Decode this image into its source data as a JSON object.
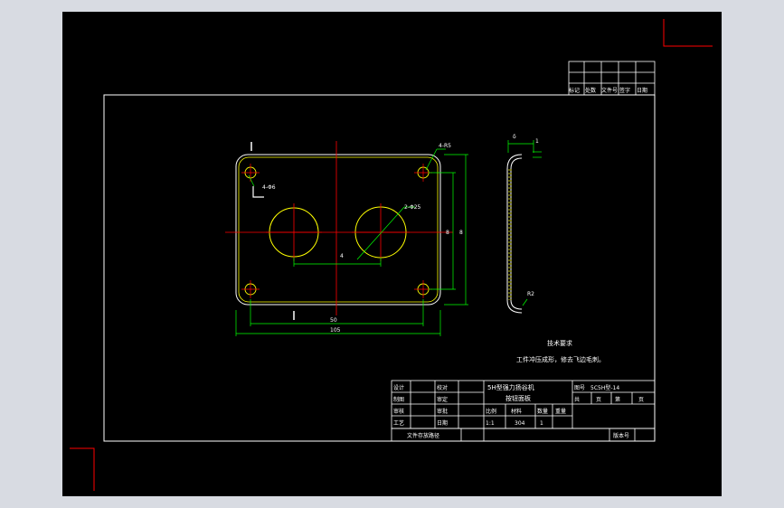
{
  "colors": {
    "background": "#000000",
    "frame": "#ffffff",
    "part_outline": "#ffff00",
    "centerline": "#ff0000",
    "dimension": "#00ff00",
    "corner_mark": "#ff0000"
  },
  "revision_table": {
    "headers": [
      "标记",
      "处数",
      "文件号",
      "签字",
      "日期"
    ]
  },
  "dimensions": {
    "corner_holes": "4-Φ6",
    "corner_radius": "4-R5",
    "large_holes": "2-Φ25",
    "hole_spacing": "4",
    "inner_height": "8",
    "outer_height": "8",
    "inner_width": "50",
    "outer_width": "105"
  },
  "side_view": {
    "thickness_label": "δ",
    "lip_label": "1",
    "radius_label": "R2"
  },
  "technical_requirements": {
    "heading": "技术要求",
    "text": "工件冲压成形，修去飞边毛刺。"
  },
  "title_block": {
    "labels": {
      "design": "设计",
      "check": "校对",
      "drawing": "制图",
      "review": "审定",
      "audit": "审核",
      "approve": "审批",
      "process": "工艺",
      "date": "日期",
      "scale": "比例",
      "material": "材料",
      "quantity": "数量",
      "weight": "重量",
      "drawing_no_label": "图号",
      "total": "共",
      "sheet_unit": "页",
      "sheet_no": "第",
      "file_path": "文件存放路径",
      "version": "版本号"
    },
    "product_name": "5H型强力扬谷机",
    "part_name": "按钮面板",
    "drawing_no": "5C5H型-14",
    "scale_value": "1:1",
    "material_value": "304",
    "quantity_value": "1"
  }
}
